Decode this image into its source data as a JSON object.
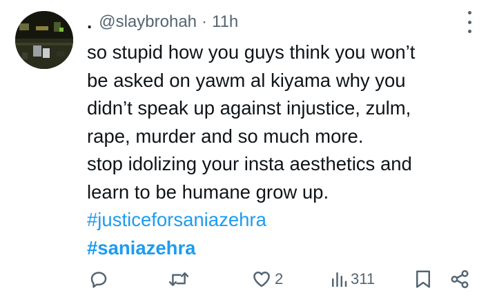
{
  "post": {
    "display_name": ".",
    "handle": "@slaybrohah",
    "separator": "·",
    "time": "11h",
    "lines": [
      "so stupid how you guys think you won’t",
      "be asked on yawm al kiyama why you",
      "didn’t speak up against injustice, zulm,",
      "rape, murder and so much more.",
      "stop idolizing your insta aesthetics and",
      "learn to be humane grow up."
    ],
    "hashtags": [
      "#justiceforsaniazehra",
      "#saniazehra"
    ]
  },
  "actions": {
    "reply": {
      "icon": "reply-icon"
    },
    "repost": {
      "icon": "repost-icon"
    },
    "like": {
      "icon": "heart-icon",
      "count": "2"
    },
    "views": {
      "icon": "views-icon",
      "count": "311"
    },
    "bookmark": {
      "icon": "bookmark-icon"
    },
    "share": {
      "icon": "share-icon"
    }
  },
  "colors": {
    "text": "#0f1419",
    "muted": "#536471",
    "link": "#1d9bf0",
    "background": "#ffffff"
  }
}
